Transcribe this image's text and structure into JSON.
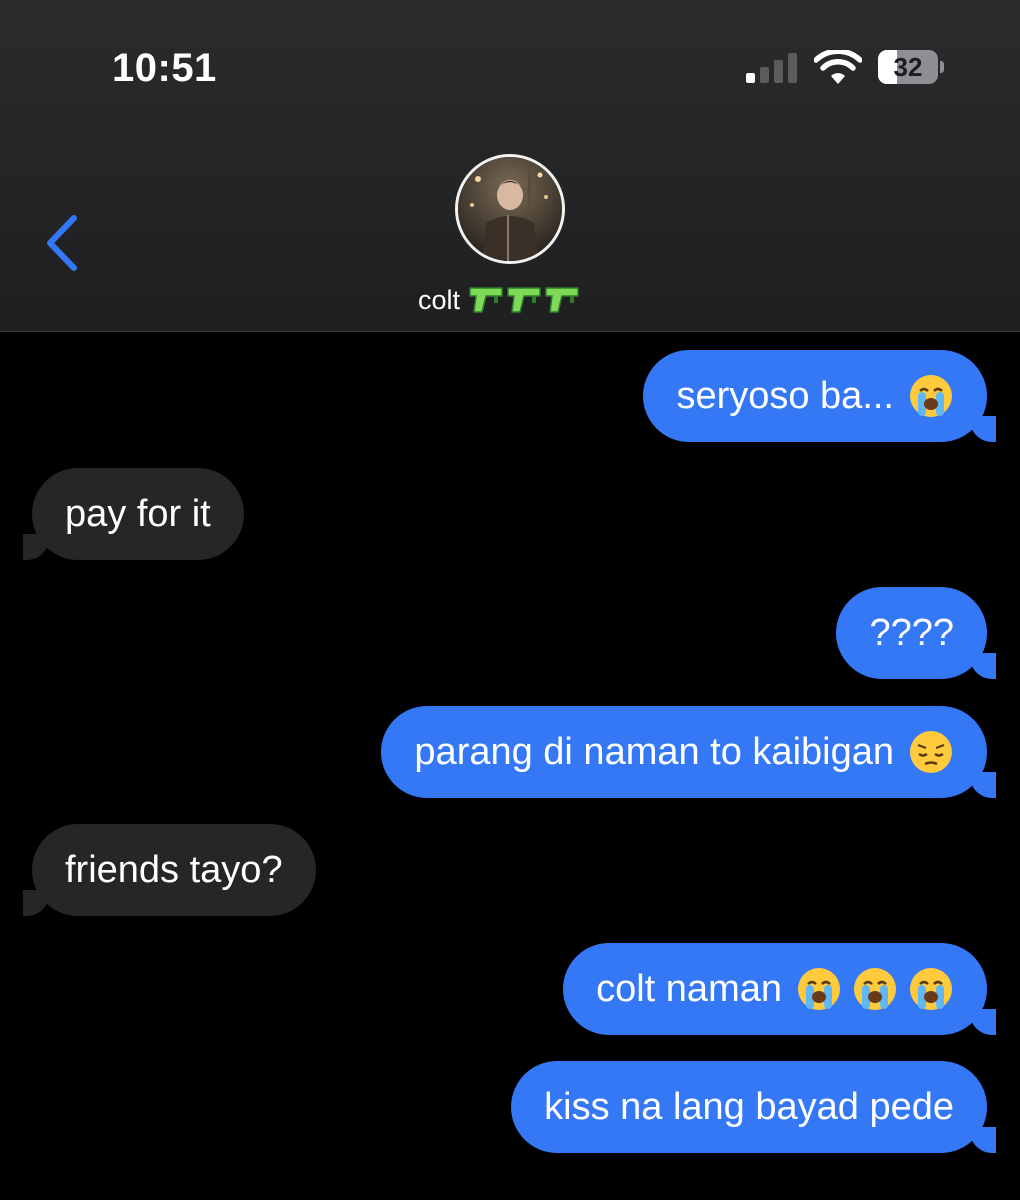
{
  "status_bar": {
    "time": "10:51",
    "battery_level": "32",
    "signal_bars_active": 1,
    "signal_bars_total": 4
  },
  "contact": {
    "name": "colt",
    "name_emoji": [
      "water-pistol-icon",
      "water-pistol-icon",
      "water-pistol-icon"
    ]
  },
  "messages": [
    {
      "direction": "sent",
      "text": "seryoso ba...",
      "emoji": [
        "loudly-crying-face-icon"
      ]
    },
    {
      "direction": "received",
      "text": "pay for it",
      "emoji": []
    },
    {
      "direction": "sent",
      "text": "????",
      "emoji": []
    },
    {
      "direction": "sent",
      "text": "parang di naman to kaibigan",
      "emoji": [
        "pensive-face-icon"
      ]
    },
    {
      "direction": "received",
      "text": "friends tayo?",
      "emoji": []
    },
    {
      "direction": "sent",
      "text": "colt naman",
      "emoji": [
        "loudly-crying-face-icon",
        "loudly-crying-face-icon",
        "loudly-crying-face-icon"
      ]
    },
    {
      "direction": "sent",
      "text": "kiss na lang bayad pede",
      "emoji": []
    }
  ],
  "colors": {
    "sent_bubble": "#3478f6",
    "received_bubble": "#262628",
    "accent": "#3478f6",
    "background": "#000000"
  }
}
